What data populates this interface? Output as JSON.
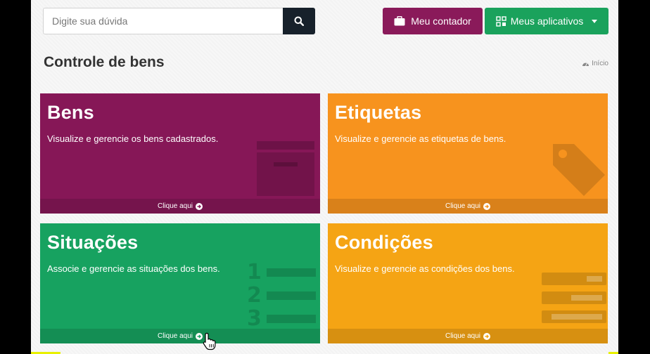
{
  "header": {
    "search_placeholder": "Digite sua dúvida",
    "accountant_button": "Meu contador",
    "apps_button": "Meus aplicativos"
  },
  "page": {
    "title": "Controle de bens",
    "breadcrumb": "Início"
  },
  "tiles": [
    {
      "title": "Bens",
      "description": "Visualize e gerencie os bens cadastrados.",
      "link": "Clique aqui",
      "color": "#861757",
      "icon": "folder-icon"
    },
    {
      "title": "Etiquetas",
      "description": "Visualize e gerencie as etiquetas de bens.",
      "link": "Clique aqui",
      "color": "#f7931e",
      "icon": "tag-icon"
    },
    {
      "title": "Situações",
      "description": "Associe e gerencie as situações dos bens.",
      "link": "Clique aqui",
      "color": "#17a260",
      "icon": "numbered-list-icon"
    },
    {
      "title": "Condições",
      "description": "Visualize e gerencie as condições dos bens.",
      "link": "Clique aqui",
      "color": "#f5a414",
      "icon": "tasks-icon"
    }
  ],
  "colors": {
    "search_button": "#17212b",
    "accountant_button": "#8a1a5a",
    "apps_button": "#1aa25c"
  }
}
